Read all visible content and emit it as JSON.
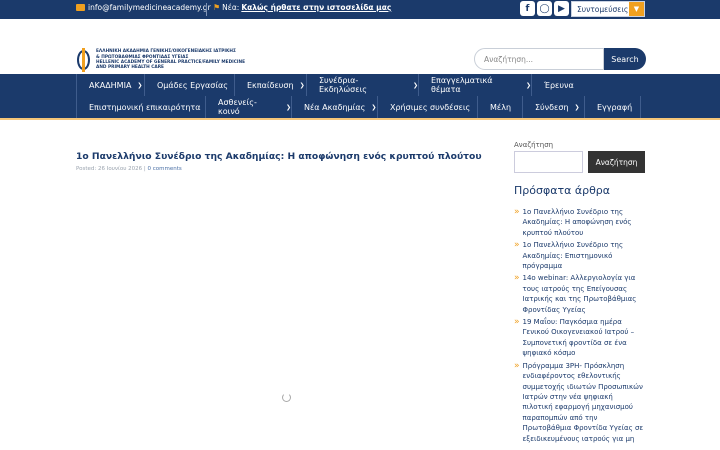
{
  "colors": {
    "primary": "#1b3a6b",
    "accent": "#f0a020"
  },
  "topbar": {
    "email": "info@familymedicineacademy.gr",
    "news_label": "Νέα:",
    "news_text": "Καλώς ήρθατε στην ιστοσελίδα μας",
    "social_icons": [
      "facebook-icon",
      "instagram-icon",
      "youtube-icon"
    ],
    "shortcuts_label": "Συντομεύσεις"
  },
  "header": {
    "logo_lines": [
      "ΕΛΛΗΝΙΚΗ ΑΚΑΔΗΜΙΑ ΓΕΝΙΚΗΣ/ΟΙΚΟΓΕΝΕΙΑΚΗΣ ΙΑΤΡΙΚΗΣ",
      "& ΠΡΩΤΟΒΑΘΜΙΑΣ ΦΡΟΝΤΙΔΑΣ ΥΓΕΙΑΣ",
      "HELLENIC ACADEMY OF GENERAL PRACTICE/FAMILY MEDICINE",
      "AND PRIMARY HEALTH CARE"
    ],
    "search_placeholder": "Αναζήτηση...",
    "search_button": "Search"
  },
  "nav": {
    "row1": [
      {
        "label": "ΑΚΑΔΗΜΙΑ",
        "dropdown": true
      },
      {
        "label": "Ομάδες Εργασίας",
        "dropdown": false
      },
      {
        "label": "Εκπαίδευση",
        "dropdown": true
      },
      {
        "label": "Συνέδρια- Εκδηλώσεις",
        "dropdown": true
      },
      {
        "label": "Επαγγελματικά θέματα",
        "dropdown": true
      },
      {
        "label": "Έρευνα",
        "dropdown": false
      }
    ],
    "row2": [
      {
        "label": "Επιστημονική επικαιρότητα",
        "dropdown": false
      },
      {
        "label": "Ασθενείς- κοινό",
        "dropdown": true
      },
      {
        "label": "Νέα Ακαδημίας",
        "dropdown": true
      },
      {
        "label": "Χρήσιμες συνδέσεις",
        "dropdown": false
      },
      {
        "label": "Μέλη",
        "dropdown": false
      },
      {
        "label": "Σύνδεση",
        "dropdown": true
      },
      {
        "label": "Εγγραφή",
        "dropdown": false
      }
    ]
  },
  "post": {
    "title": "1ο Πανελλήνιο Συνέδριο της Ακαδημίας: Η αποφώνηση ενός κρυπτού πλούτου",
    "date": "Posted: 26 Ιουνίου 2026",
    "comments": "0 comments"
  },
  "sidebar": {
    "search_label": "Αναζήτηση",
    "search_button": "Αναζήτηση",
    "recent_title": "Πρόσφατα άρθρα",
    "recent": [
      "1ο Πανελλήνιο Συνέδριο της Ακαδημίας: Η αποφώνηση ενός κρυπτού πλούτου",
      "1ο Πανελλήνιο Συνέδριο της Ακαδημίας: Επιστημονικό πρόγραμμα",
      "14ο webinar: Αλλεργιολογία για τους ιατρούς της Επείγουσας Ιατρικής και της Πρωτοβάθμιας Φροντίδας Υγείας",
      "19 Μαΐου: Παγκόσμια ημέρα Γενικού Οικογενειακού Ιατρού – Συμπονετική φροντίδα σε ένα ψηφιακό κόσμο",
      "Πρόγραμμα 3ΡΗ- Πρόσκληση ενδιαφέροντος εθελοντικής συμμετοχής ιδιωτών Προσωπικών Ιατρών στην νέα ψηφιακή πιλοτική εφαρμογή μηχανισμού παραπομπών από την Πρωτοβάθμια Φροντίδα Υγείας σε εξειδικευμένους ιατρούς για μη"
    ]
  }
}
